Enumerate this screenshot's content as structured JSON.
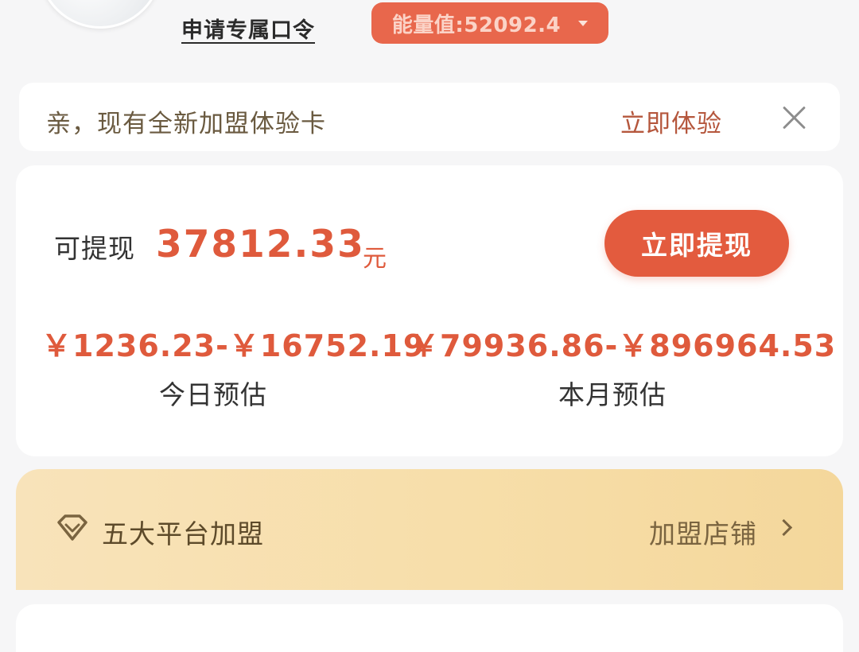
{
  "header": {
    "token_link": "申请专属口令",
    "energy_label": "能量值:52092.4"
  },
  "notice": {
    "message": "亲，现有全新加盟体验卡",
    "cta": "立即体验"
  },
  "balance": {
    "withdraw_label": "可提现",
    "withdraw_amount": "37812.33",
    "withdraw_unit": "元",
    "withdraw_button": "立即提现",
    "today_range": "￥1236.23-￥16752.19",
    "today_label": "今日预估",
    "month_range": "￥79936.86-￥896964.53",
    "month_label": "本月预估"
  },
  "franchise": {
    "title": "五大平台加盟",
    "link": "加盟店铺"
  },
  "colors": {
    "accent": "#e35b3e",
    "amount_text": "#df5a3c",
    "gold_banner": "#f7dea9"
  }
}
